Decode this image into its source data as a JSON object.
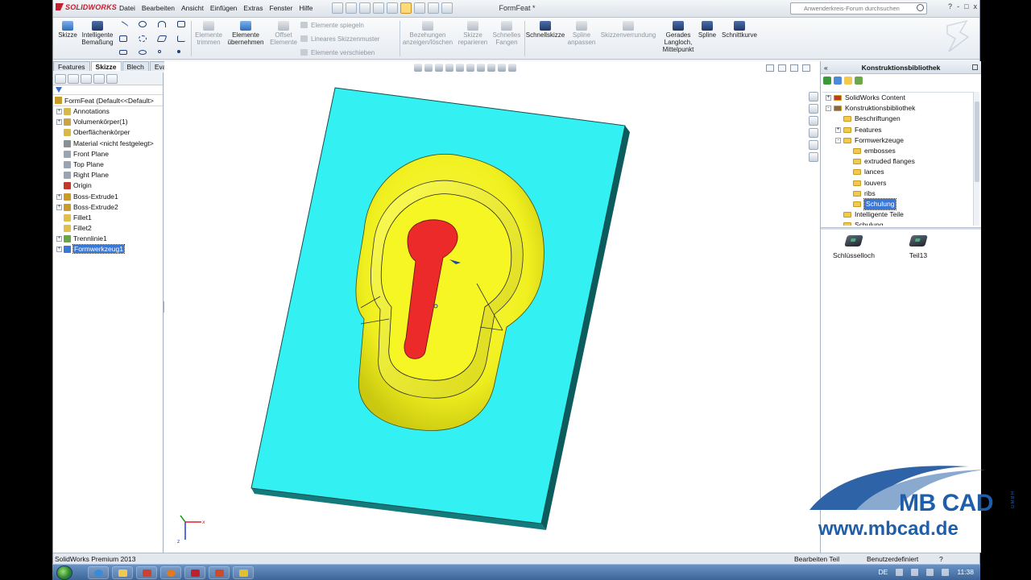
{
  "app": {
    "logo": "SOLIDWORKS",
    "document_title": "FormFeat *",
    "menus": [
      "Datei",
      "Bearbeiten",
      "Ansicht",
      "Einfügen",
      "Extras",
      "Fenster",
      "Hilfe"
    ],
    "search_placeholder": "Anwenderkreis-Forum durchsuchen",
    "window_controls": [
      "?",
      "-",
      "□",
      "x"
    ]
  },
  "ribbon": {
    "skizze": "Skizze",
    "bemassung": "Intelligente Bemaßung",
    "elemente_trimmen": "Elemente trimmen",
    "elemente_uebernehmen": "Elemente übernehmen",
    "offset_elemente": "Offset Elemente",
    "elemente_spiegeln": "Elemente spiegeln",
    "lineares_skizzenmuster": "Lineares Skizzenmuster",
    "elemente_verschieben": "Elemente verschieben",
    "beziehungen": "Bezehungen anzeigen/löschen",
    "skizze_reparieren": "Skizze reparieren",
    "schnelles_fangen": "Schnelles Fangen",
    "schnellskizze": "Schnellskizze",
    "spline_anpassen": "Spline anpassen",
    "skizzenverrundung": "Skizzenverrundung",
    "gerades_langloch": "Gerades Langloch, Mittelpunkt",
    "spline": "Spline",
    "schnittkurve": "Schnittkurve"
  },
  "tabs": [
    "Features",
    "Skizze",
    "Blech",
    "Evaluieren"
  ],
  "active_tab": "Skizze",
  "feature_tree": {
    "root": "FormFeat  (Default<<Default>",
    "items": [
      {
        "label": "Annotations",
        "exp": true,
        "color": "#d9b84a"
      },
      {
        "label": "Volumenkörper(1)",
        "exp": true,
        "color": "#c9a24a"
      },
      {
        "label": "Oberflächenkörper",
        "exp": false,
        "color": "#d9b84a"
      },
      {
        "label": "Material <nicht festgelegt>",
        "exp": false,
        "color": "#8a8f96"
      },
      {
        "label": "Front Plane",
        "exp": false,
        "color": "#9aa5b3"
      },
      {
        "label": "Top Plane",
        "exp": false,
        "color": "#9aa5b3"
      },
      {
        "label": "Right Plane",
        "exp": false,
        "color": "#9aa5b3"
      },
      {
        "label": "Origin",
        "exp": false,
        "color": "#c0392b"
      },
      {
        "label": "Boss-Extrude1",
        "exp": true,
        "color": "#c99b2a"
      },
      {
        "label": "Boss-Extrude2",
        "exp": true,
        "color": "#c99b2a"
      },
      {
        "label": "Fillet1",
        "exp": false,
        "color": "#e0c04a"
      },
      {
        "label": "Fillet2",
        "exp": false,
        "color": "#e0c04a"
      },
      {
        "label": "Trennlinie1",
        "exp": true,
        "color": "#6ba34a"
      },
      {
        "label": "Formwerkzeug1",
        "exp": true,
        "color": "#3a78d8",
        "selected": true
      }
    ]
  },
  "task_pane": {
    "title": "Konstruktionsbibliothek",
    "tree": [
      {
        "label": "SolidWorks Content",
        "indent": 0,
        "exp": "+",
        "folder": "#c0392b"
      },
      {
        "label": "Konstruktionsbibliothek",
        "indent": 0,
        "exp": "-",
        "folder": "#8a6a3a"
      },
      {
        "label": "Beschriftungen",
        "indent": 1,
        "exp": "",
        "folder": "#f1c94f"
      },
      {
        "label": "Features",
        "indent": 1,
        "exp": "+",
        "folder": "#f1c94f"
      },
      {
        "label": "Formwerkzeuge",
        "indent": 1,
        "exp": "-",
        "folder": "#f1c94f"
      },
      {
        "label": "embosses",
        "indent": 2,
        "exp": "",
        "folder": "#f1c94f"
      },
      {
        "label": "extruded flanges",
        "indent": 2,
        "exp": "",
        "folder": "#f1c94f"
      },
      {
        "label": "lances",
        "indent": 2,
        "exp": "",
        "folder": "#f1c94f"
      },
      {
        "label": "louvers",
        "indent": 2,
        "exp": "",
        "folder": "#f1c94f"
      },
      {
        "label": "ribs",
        "indent": 2,
        "exp": "",
        "folder": "#f1c94f"
      },
      {
        "label": "Schulung",
        "indent": 2,
        "exp": "",
        "folder": "#f1c94f",
        "selected": true
      },
      {
        "label": "Intelligente Teile",
        "indent": 1,
        "exp": "",
        "folder": "#f1c94f"
      },
      {
        "label": "Schulung",
        "indent": 1,
        "exp": "",
        "folder": "#f1c94f"
      }
    ],
    "parts": [
      "Schlüsselloch",
      "Teil13"
    ]
  },
  "watermark": {
    "brand": "MB CAD",
    "gmbh": "GMBH",
    "url": "www.mbcad.de"
  },
  "status": {
    "product": "SolidWorks Premium 2013",
    "mode": "Bearbeiten Teil",
    "definition": "Benutzerdefiniert"
  },
  "taskbar": {
    "lang": "DE",
    "time": "11:38"
  },
  "colors": {
    "plate": "#33f0f2",
    "plate_edge": "#0c5c5e",
    "form": "#f3f31f",
    "keyhole": "#ec2a2a"
  }
}
